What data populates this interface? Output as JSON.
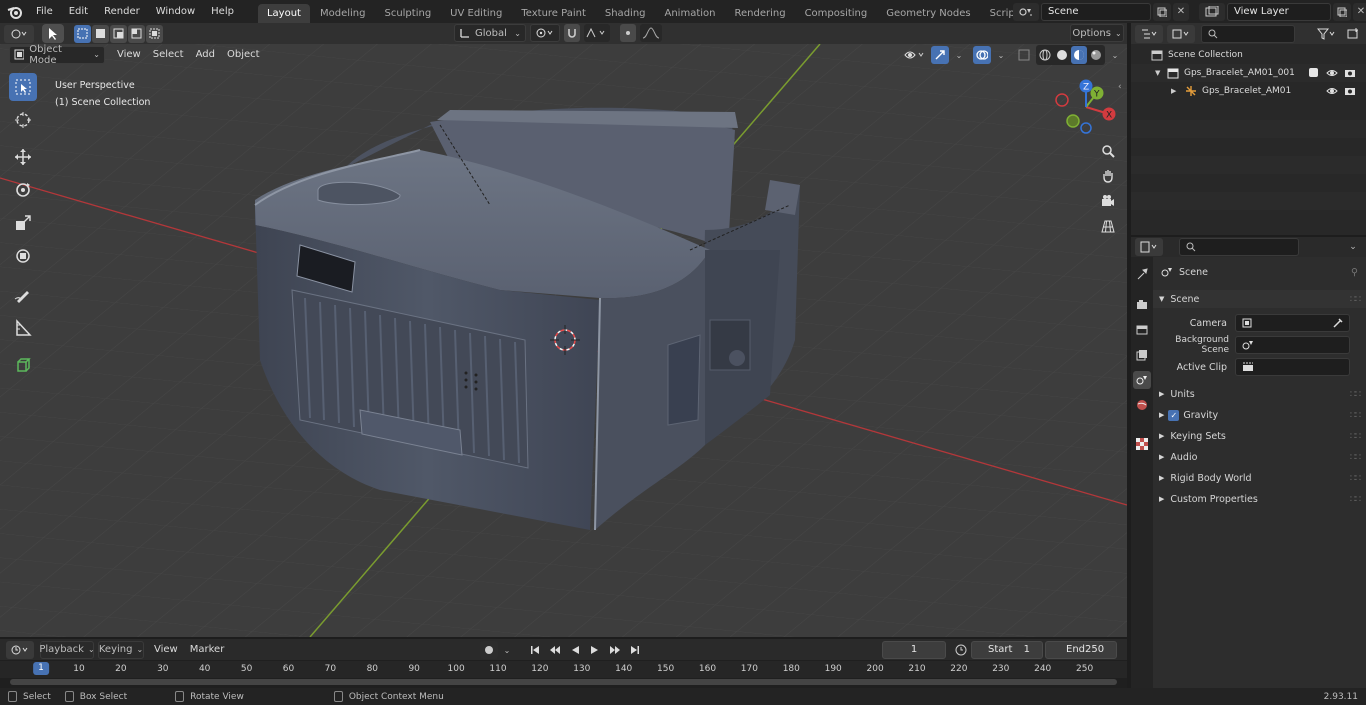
{
  "topbar": {
    "menus": [
      "File",
      "Edit",
      "Render",
      "Window",
      "Help"
    ],
    "workspaces": [
      "Layout",
      "Modeling",
      "Sculpting",
      "UV Editing",
      "Texture Paint",
      "Shading",
      "Animation",
      "Rendering",
      "Compositing",
      "Geometry Nodes",
      "Scripting"
    ],
    "active_workspace": "Layout",
    "scene_name": "Scene",
    "view_layer": "View Layer"
  },
  "viewport": {
    "header_transform": "Global",
    "options_label": "Options",
    "mode": "Object Mode",
    "menus": [
      "View",
      "Select",
      "Add",
      "Object"
    ],
    "info_line1": "User Perspective",
    "info_line2": "(1) Scene Collection",
    "gizmo": {
      "x": "X",
      "y": "Y",
      "z": "Z"
    }
  },
  "outliner": {
    "root": "Scene Collection",
    "items": [
      {
        "name": "Gps_Bracelet_AM01_001"
      },
      {
        "name": "Gps_Bracelet_AM01"
      }
    ]
  },
  "properties": {
    "context": "Scene",
    "section": "Scene",
    "fields": [
      {
        "label": "Camera"
      },
      {
        "label": "Background Scene"
      },
      {
        "label": "Active Clip"
      }
    ],
    "panels": [
      "Units",
      "Gravity",
      "Keying Sets",
      "Audio",
      "Rigid Body World",
      "Custom Properties"
    ],
    "gravity_checked": true
  },
  "timeline": {
    "menus": [
      "Playback",
      "Keying",
      "View",
      "Marker"
    ],
    "current_frame": "1",
    "start_label": "Start",
    "start": "1",
    "end_label": "End",
    "end": "250",
    "ruler": [
      "1",
      "10",
      "20",
      "30",
      "40",
      "50",
      "60",
      "70",
      "80",
      "90",
      "100",
      "110",
      "120",
      "130",
      "140",
      "150",
      "160",
      "170",
      "180",
      "190",
      "200",
      "210",
      "220",
      "230",
      "240",
      "250"
    ]
  },
  "statusbar": {
    "select": "Select",
    "box_select": "Box Select",
    "rotate": "Rotate View",
    "context_menu": "Object Context Menu",
    "version": "2.93.11"
  },
  "colors": {
    "accent": "#4772b3",
    "x_axis": "#c0393d",
    "y_axis": "#7ca13a",
    "z_axis": "#2f6fdb"
  }
}
